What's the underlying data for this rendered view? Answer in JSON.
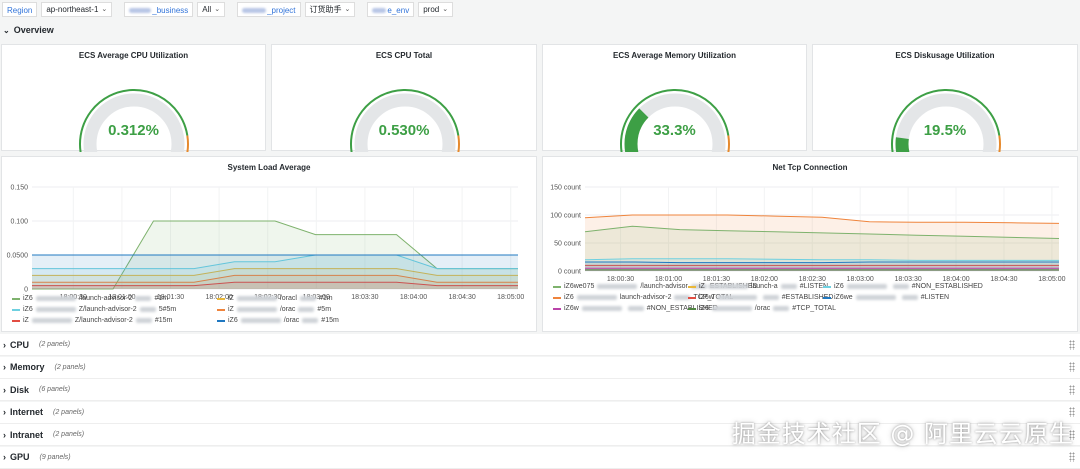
{
  "variables": {
    "region_label": "Region",
    "region_value": "ap-northeast-1",
    "business_label": "_business",
    "business_value": "All",
    "project_label": "_project",
    "project_value": "订货助手",
    "env_label": "e_env",
    "env_value": "prod"
  },
  "overview": {
    "title": "Overview"
  },
  "gauges": [
    {
      "title": "ECS Average CPU Utilization",
      "value_text": "0.312%",
      "value": 0.312
    },
    {
      "title": "ECS CPU Total",
      "value_text": "0.530%",
      "value": 0.53
    },
    {
      "title": "ECS Average Memory Utilization",
      "value_text": "33.3%",
      "value": 33.3
    },
    {
      "title": "ECS Diskusage Utilization",
      "value_text": "19.5%",
      "value": 19.5
    }
  ],
  "colors": {
    "green": "#3d9f45",
    "orange": "#e68a2e",
    "red": "#d44a3a",
    "track": "#e4e6e8"
  },
  "load_chart": {
    "title": "System Load Average",
    "chart_data": {
      "type": "area",
      "title": "System Load Average",
      "ylim": [
        0,
        0.15
      ],
      "yticks": [
        "0.150",
        "0.100",
        "0.0500",
        "0"
      ],
      "xticks": [
        "18:00:30",
        "18:01:00",
        "18:01:30",
        "18:02:00",
        "18:02:30",
        "18:03:00",
        "18:03:30",
        "18:04:00",
        "18:04:30",
        "18:05:00"
      ],
      "x": [
        "18:00:00",
        "18:00:30",
        "18:00:50",
        "18:01:00",
        "18:01:30",
        "18:02:00",
        "18:02:30",
        "18:03:00",
        "18:03:30",
        "18:03:50",
        "18:04:00",
        "18:04:30",
        "18:05:00"
      ],
      "series": [
        {
          "color": "#7eb26d",
          "values": [
            0,
            0,
            0,
            0.1,
            0.1,
            0.1,
            0.1,
            0.08,
            0.08,
            0.08,
            0.03,
            0.03,
            0.03
          ]
        },
        {
          "color": "#eab839",
          "values": [
            0.02,
            0.02,
            0.02,
            0.02,
            0.02,
            0.03,
            0.03,
            0.03,
            0.03,
            0.03,
            0.02,
            0.02,
            0.02
          ]
        },
        {
          "color": "#6ed0e0",
          "values": [
            0.03,
            0.03,
            0.03,
            0.03,
            0.03,
            0.04,
            0.04,
            0.05,
            0.05,
            0.05,
            0.03,
            0.03,
            0.03
          ]
        },
        {
          "color": "#ef843c",
          "values": [
            0.01,
            0.01,
            0.01,
            0.01,
            0.01,
            0.02,
            0.02,
            0.02,
            0.02,
            0.02,
            0.01,
            0.01,
            0.01
          ]
        },
        {
          "color": "#e24d42",
          "values": [
            0.005,
            0.005,
            0.005,
            0.005,
            0.005,
            0.01,
            0.01,
            0.01,
            0.01,
            0.01,
            0.005,
            0.005,
            0.005
          ]
        },
        {
          "color": "#1f78c1",
          "values": [
            0.05,
            0.05,
            0.05,
            0.05,
            0.05,
            0.05,
            0.05,
            0.05,
            0.05,
            0.05,
            0.05,
            0.05,
            0.05
          ]
        }
      ]
    },
    "legend": [
      {
        "color": "#7eb26d",
        "prefix": "iZ6",
        "text": "/launch-advisor-2",
        "suffix": "#1m"
      },
      {
        "color": "#eab839",
        "prefix": "iZ",
        "text": "/oracl",
        "suffix": "#1m"
      },
      {
        "color": "#6ed0e0",
        "prefix": "iZ6",
        "text": "Z/launch-advisor-2",
        "suffix": "5#5m"
      },
      {
        "color": "#ef843c",
        "prefix": "iZ",
        "text": "/orac",
        "suffix": "#5m"
      },
      {
        "color": "#e24d42",
        "prefix": "iZ",
        "text": "Z/launch-advisor-2",
        "suffix": "#15m"
      },
      {
        "color": "#1f78c1",
        "prefix": "iZ6",
        "text": "/orac",
        "suffix": "#15m"
      }
    ]
  },
  "tcp_chart": {
    "title": "Net Tcp Connection",
    "chart_data": {
      "type": "area",
      "title": "Net Tcp Connection",
      "ylim": [
        0,
        150
      ],
      "yticks": [
        "150 count",
        "100 count",
        "50 count",
        "0 count"
      ],
      "xticks": [
        "18:00:30",
        "18:01:00",
        "18:01:30",
        "18:02:00",
        "18:02:30",
        "18:03:00",
        "18:03:30",
        "18:04:00",
        "18:04:30",
        "18:05:00"
      ],
      "x": [
        "18:00:10",
        "18:00:30",
        "18:01:00",
        "18:01:30",
        "18:02:00",
        "18:02:30",
        "18:03:00",
        "18:03:30",
        "18:04:00",
        "18:04:30",
        "18:05:00"
      ],
      "series": [
        {
          "color": "#ef843c",
          "values": [
            95,
            100,
            100,
            100,
            98,
            96,
            88,
            87,
            87,
            86,
            85
          ]
        },
        {
          "color": "#7eb26d",
          "values": [
            70,
            80,
            74,
            72,
            70,
            68,
            66,
            64,
            62,
            60,
            58
          ]
        },
        {
          "color": "#6ed0e0",
          "values": [
            20,
            22,
            22,
            22,
            21,
            20,
            20,
            19,
            19,
            19,
            19
          ]
        },
        {
          "color": "#e24d42",
          "values": [
            10,
            10,
            10,
            10,
            10,
            10,
            10,
            10,
            10,
            10,
            10
          ]
        },
        {
          "color": "#1f78c1",
          "values": [
            16,
            16,
            15,
            15,
            15,
            15,
            16,
            16,
            16,
            16,
            16
          ]
        },
        {
          "color": "#ba43a9",
          "values": [
            5,
            5,
            5,
            5,
            5,
            5,
            5,
            5,
            5,
            5,
            5
          ]
        },
        {
          "color": "#508642",
          "values": [
            2,
            2,
            2,
            2,
            2,
            2,
            2,
            2,
            2,
            2,
            2
          ]
        }
      ]
    },
    "legend": [
      {
        "color": "#7eb26d",
        "prefix": "iZ6we075",
        "text": "/launch-advisor",
        "suffix": "ESTABLISHED"
      },
      {
        "color": "#eab839",
        "prefix": "iZ",
        "text": "launch-a",
        "suffix": "#LISTEN"
      },
      {
        "color": "#6ed0e0",
        "prefix": "iZ6",
        "text": "",
        "suffix": "#NON_ESTABLISHED"
      },
      {
        "color": "#ef843c",
        "prefix": "iZ6",
        "text": "launch-advisor-2",
        "suffix": "TCP_TOTAL"
      },
      {
        "color": "#e24d42",
        "prefix": "iZ6w",
        "text": "",
        "suffix": "#ESTABLISHED"
      },
      {
        "color": "#1f78c1",
        "prefix": "iZ6we",
        "text": "",
        "suffix": "#LISTEN"
      },
      {
        "color": "#ba43a9",
        "prefix": "iZ6w",
        "text": "",
        "suffix": "#NON_ESTABLISHED"
      },
      {
        "color": "#508642",
        "prefix": "iZ6",
        "text": "/orac",
        "suffix": "#TCP_TOTAL"
      }
    ]
  },
  "rows": [
    {
      "title": "CPU",
      "panels": "(2 panels)"
    },
    {
      "title": "Memory",
      "panels": "(2 panels)"
    },
    {
      "title": "Disk",
      "panels": "(6 panels)"
    },
    {
      "title": "Internet",
      "panels": "(2 panels)"
    },
    {
      "title": "Intranet",
      "panels": "(2 panels)"
    },
    {
      "title": "GPU",
      "panels": "(9 panels)"
    }
  ],
  "watermark": "掘金技术社区 @ 阿里云云原生"
}
